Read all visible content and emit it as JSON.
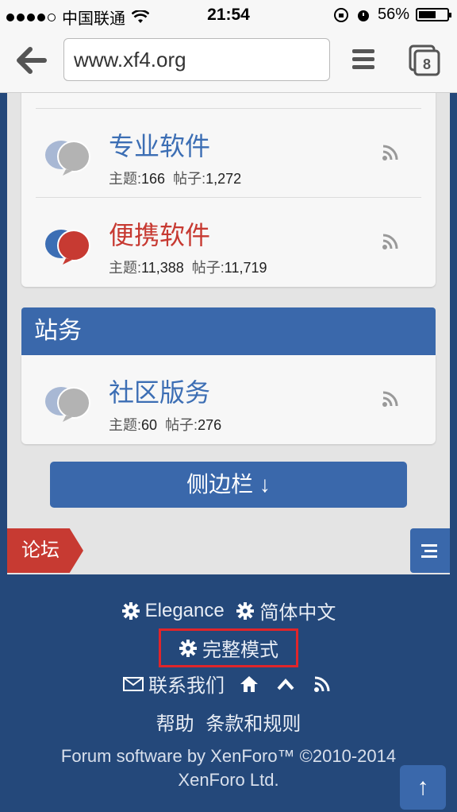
{
  "status": {
    "carrier": "中国联通",
    "time": "21:54",
    "battery": "56%"
  },
  "browser": {
    "url": "www.xf4.org",
    "tab_count": "8"
  },
  "forums": [
    {
      "title": "专业软件",
      "threads_label": "主题:",
      "threads": "166",
      "posts_label": "帖子:",
      "posts": "1,272",
      "highlight": false
    },
    {
      "title": "便携软件",
      "threads_label": "主题:",
      "threads": "11,388",
      "posts_label": "帖子:",
      "posts": "11,719",
      "highlight": true
    }
  ],
  "category": {
    "title": "站务"
  },
  "category_forums": [
    {
      "title": "社区版务",
      "threads_label": "主题:",
      "threads": "60",
      "posts_label": "帖子:",
      "posts": "276",
      "highlight": false
    }
  ],
  "sidebar_button": "侧边栏 ↓",
  "breadcrumb": "论坛",
  "footer": {
    "style": "Elegance",
    "language": "简体中文",
    "full_mode": "完整模式",
    "contact": "联系我们",
    "help": "帮助",
    "terms": "条款和规则",
    "copyright_line1": "Forum software by XenForo™ ©2010-2014",
    "copyright_line2": "XenForo Ltd.",
    "to_top": "↑"
  },
  "colors": {
    "accent": "#3a68ab",
    "footer_bg": "#24487a",
    "red": "#c73a32",
    "highlight_box": "#e0252a"
  }
}
